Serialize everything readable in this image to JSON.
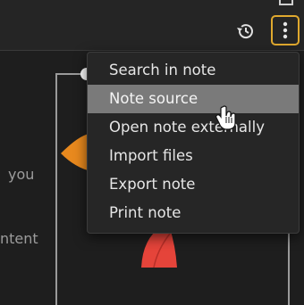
{
  "toolbar": {
    "history_icon": "history-icon",
    "menu_icon": "vertical-dots-icon",
    "accent_color": "#e0a92e"
  },
  "note": {
    "line1": "you",
    "line2": "ntent"
  },
  "menu": {
    "items": [
      {
        "label": "Search in note"
      },
      {
        "label": "Note source"
      },
      {
        "label": "Open note externally"
      },
      {
        "label": "Import files"
      },
      {
        "label": "Export note"
      },
      {
        "label": "Print note"
      }
    ],
    "hover_index": 1
  },
  "colors": {
    "orange": "#e8891e",
    "red": "#e5443a",
    "menu_hover": "#7a7a7a"
  }
}
